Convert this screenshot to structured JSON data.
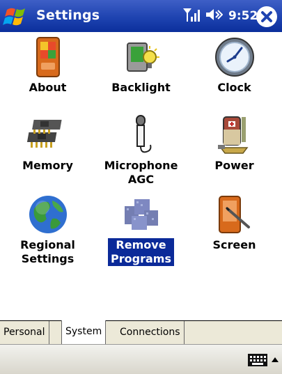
{
  "titlebar": {
    "title": "Settings",
    "time": "9:52",
    "icons": [
      "windows-start-icon",
      "signal-antenna-icon",
      "speaker-icon",
      "close-icon"
    ]
  },
  "items": [
    {
      "label": "About",
      "icon": "about-device-icon"
    },
    {
      "label": "Backlight",
      "icon": "backlight-icon"
    },
    {
      "label": "Clock",
      "icon": "clock-icon"
    },
    {
      "label": "Memory",
      "icon": "memory-chip-icon"
    },
    {
      "label": "Microphone\nAGC",
      "icon": "microphone-icon"
    },
    {
      "label": "Power",
      "icon": "battery-power-icon"
    },
    {
      "label": "Regional\nSettings",
      "icon": "globe-icon"
    },
    {
      "label": "Remove\nPrograms",
      "icon": "remove-programs-icon",
      "selected": true
    },
    {
      "label": "Screen",
      "icon": "screen-stylus-icon"
    }
  ],
  "tabs": [
    {
      "label": "Personal",
      "active": false
    },
    {
      "label": "System",
      "active": true
    },
    {
      "label": "Connections",
      "active": false
    }
  ],
  "menubar": {
    "icons": [
      "keyboard-icon",
      "up-arrow-icon"
    ]
  },
  "colors": {
    "titlebar": "#1e43b0",
    "selection": "#0b2a99",
    "tab_bar": "#ece9d8"
  }
}
